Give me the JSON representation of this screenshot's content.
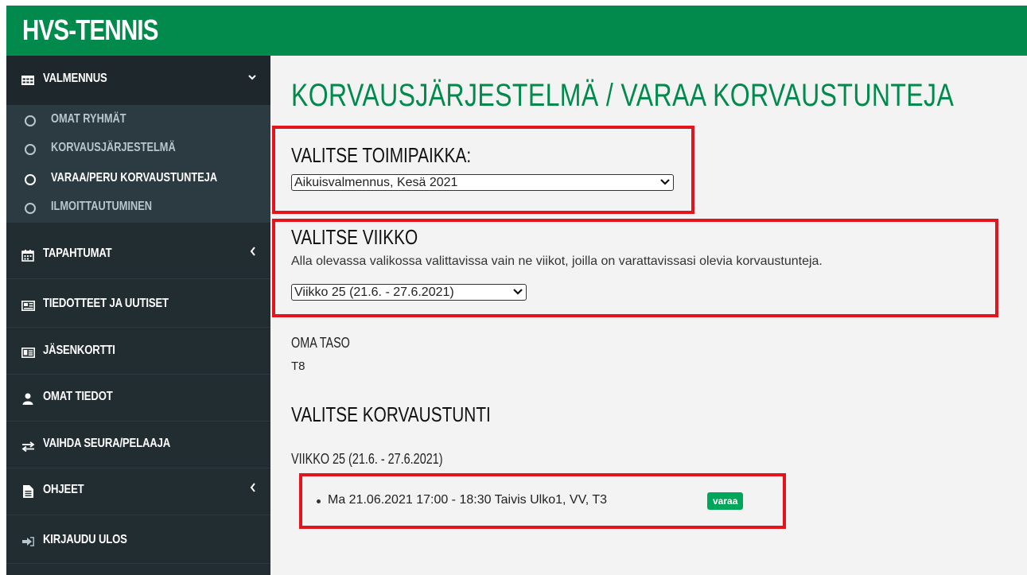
{
  "app": {
    "brand": "HVS-TENNIS"
  },
  "sidebar": {
    "items": [
      {
        "label": "VALMENNUS",
        "icon": "table-icon",
        "chevron": "⌄"
      },
      {
        "label": "TAPAHTUMAT",
        "icon": "calendar-icon",
        "chevron": "‹"
      },
      {
        "label": "TIEDOTTEET JA UUTISET",
        "icon": "newspaper-icon"
      },
      {
        "label": "JÄSENKORTTI",
        "icon": "id-card-icon"
      },
      {
        "label": "OMAT TIEDOT",
        "icon": "user-icon"
      },
      {
        "label": "VAIHDA SEURA/PELAAJA",
        "icon": "exchange-icon"
      },
      {
        "label": "OHJEET",
        "icon": "file-icon",
        "chevron": "‹"
      },
      {
        "label": "KIRJAUDU ULOS",
        "icon": "sign-out-icon"
      }
    ],
    "submenu": [
      {
        "label": "OMAT RYHMÄT"
      },
      {
        "label": "KORVAUSJÄRJESTELMÄ"
      },
      {
        "label": "VARAA/PERU KORVAUSTUNTEJA"
      },
      {
        "label": "ILMOITTAUTUMINEN"
      }
    ]
  },
  "main": {
    "title": "KORVAUSJÄRJESTELMÄ / VARAA KORVAUSTUNTEJA",
    "location": {
      "title": "VALITSE TOIMIPAIKKA:",
      "selected": "Aikuisvalmennus, Kesä 2021"
    },
    "week": {
      "title": "VALITSE VIIKKO",
      "hint": "Alla olevassa valikossa valittavissa vain ne viikot, joilla on varattavissasi olevia korvaustunteja.",
      "selected": "Viikko 25 (21.6. - 27.6.2021)"
    },
    "level": {
      "label": "OMA TASO",
      "value": "T8"
    },
    "lesson": {
      "title": "VALITSE KORVAUSTUNTI",
      "week_label": "VIIKKO 25 (21.6. - 27.6.2021)",
      "slot": "Ma 21.06.2021 17:00 - 18:30 Taivis Ulko1, VV, T3",
      "button": "varaa"
    }
  },
  "colors": {
    "brand": "#018a4b",
    "sidebar": "#222d32",
    "highlight": "#e3141c",
    "button": "#00a65a"
  }
}
